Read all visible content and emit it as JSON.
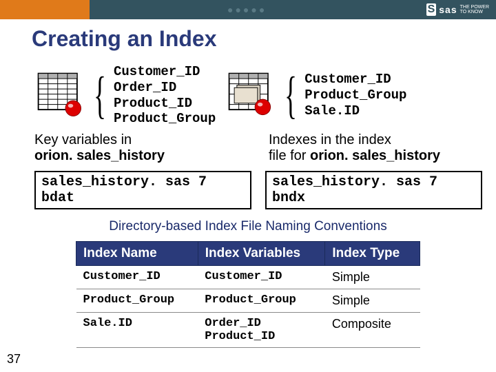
{
  "brand": {
    "s": "S",
    "sas": "sas",
    "power1": "THE POWER",
    "power2": "TO KNOW"
  },
  "title": "Creating an Index",
  "left_vars": {
    "l1": "Customer_ID",
    "l2": "Order_ID",
    "l3": "Product_ID",
    "l4": "Product_Group"
  },
  "right_vars": {
    "l1": "Customer_ID",
    "l2": "Product_Group",
    "l3": "Sale.ID"
  },
  "cap_left_a": "Key variables in",
  "cap_left_b": "orion. sales_history",
  "cap_right_a": "Indexes in the index",
  "cap_right_b": "file for ",
  "cap_right_c": "orion. sales_history",
  "file_left": "sales_history. sas 7 bdat",
  "file_right": "sales_history. sas 7 bndx",
  "subtitle": "Directory-based Index File Naming Conventions",
  "th": {
    "c1": "Index Name",
    "c2": "Index Variables",
    "c3": "Index Type"
  },
  "rows": [
    {
      "name": "Customer_ID",
      "vars": "Customer_ID",
      "vars2": "",
      "type": "Simple"
    },
    {
      "name": "Product_Group",
      "vars": "Product_Group",
      "vars2": "",
      "type": "Simple"
    },
    {
      "name": "Sale.ID",
      "vars": "Order_ID",
      "vars2": "Product_ID",
      "type": "Composite"
    }
  ],
  "page": "37"
}
